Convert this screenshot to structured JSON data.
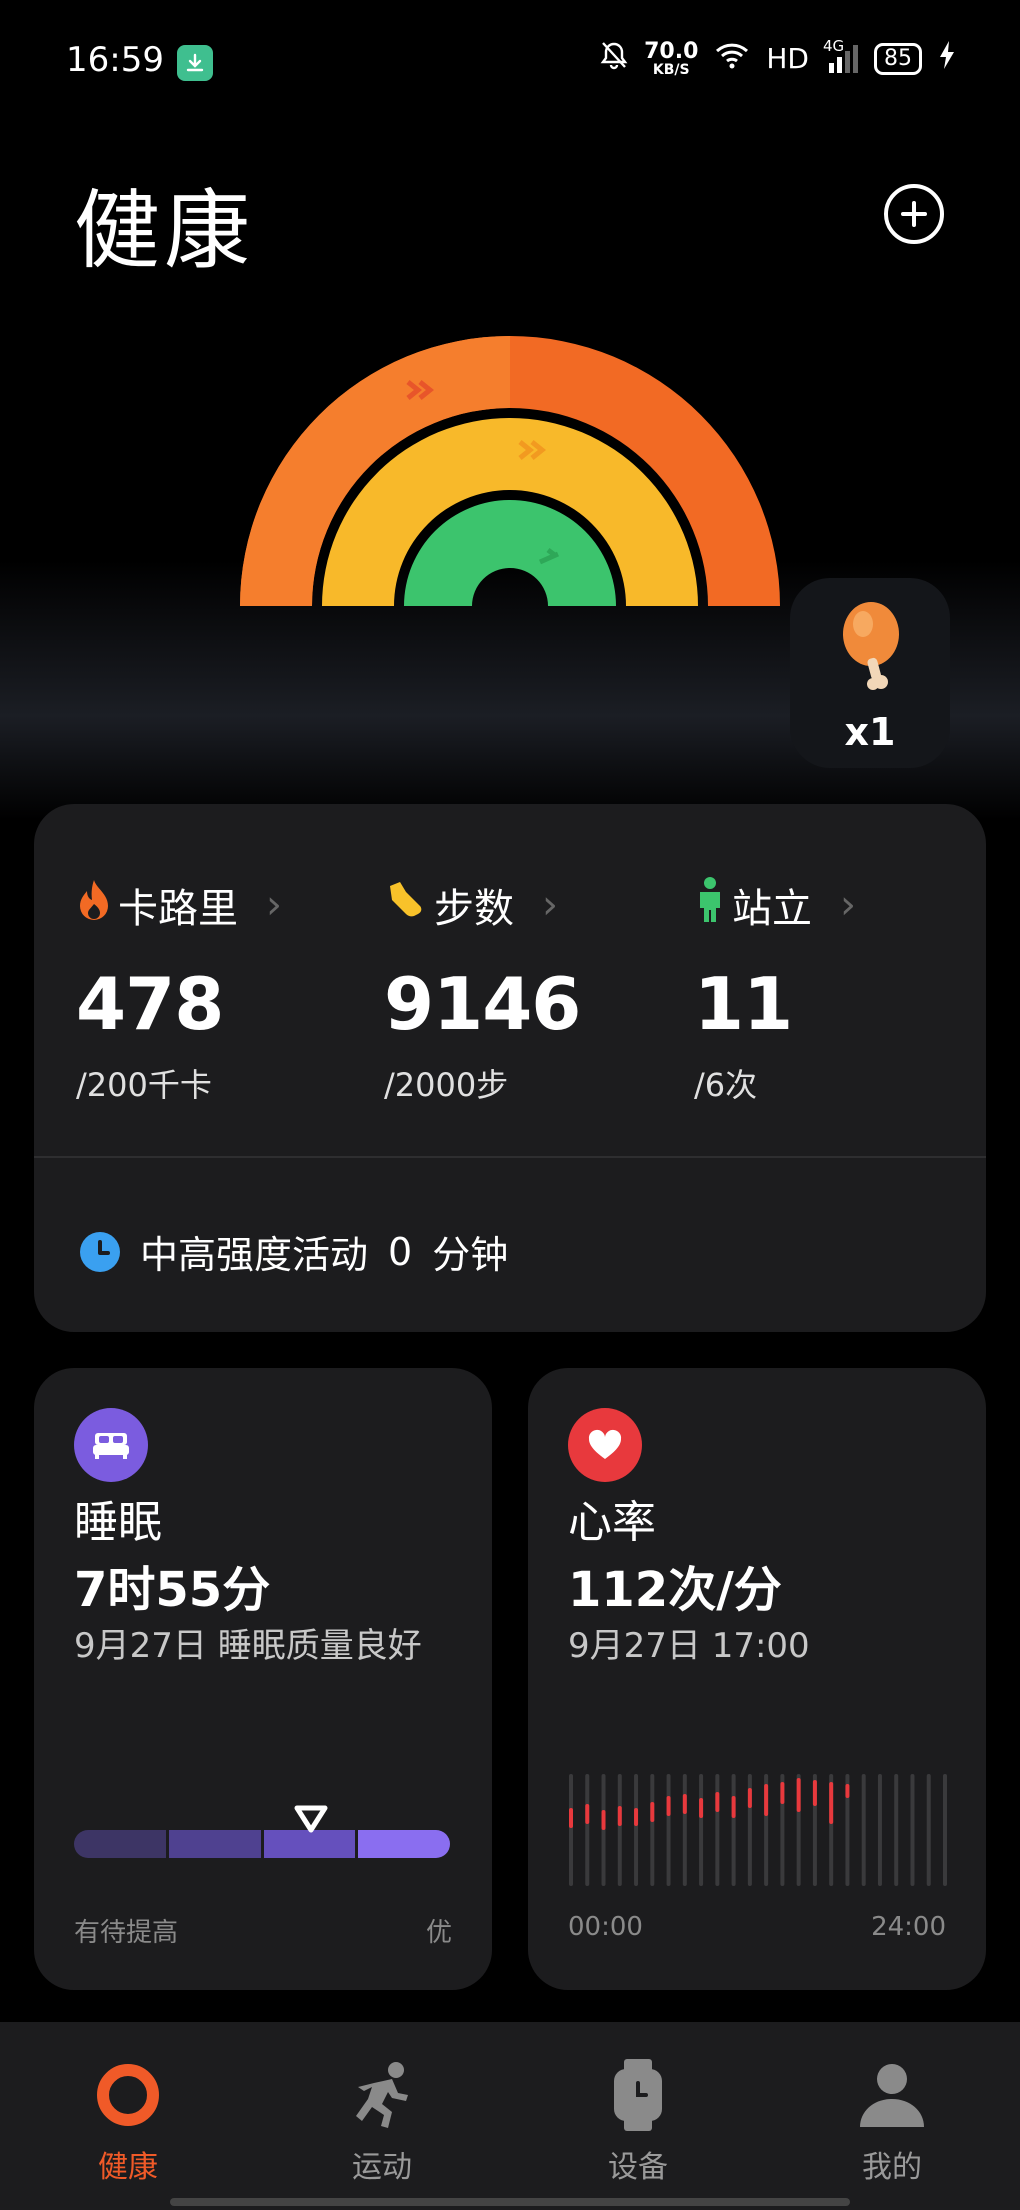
{
  "status_bar": {
    "time": "16:59",
    "net_speed_value": "70.0",
    "net_speed_unit": "KB/S",
    "hd": "HD",
    "network": "4G",
    "battery": "85"
  },
  "header": {
    "title": "健康"
  },
  "rings": {
    "colors": {
      "outer": "#f26a24",
      "middle": "#f8b92a",
      "inner": "#3cc46d"
    }
  },
  "reward": {
    "count": "x1",
    "icon": "drumstick-icon"
  },
  "activity": {
    "metrics": [
      {
        "label": "卡路里",
        "value": "478",
        "goal": "/200千卡",
        "icon": "flame-icon",
        "color": "#f26a24"
      },
      {
        "label": "步数",
        "value": "9146",
        "goal": "/2000步",
        "icon": "shoe-icon",
        "color": "#f8c22a"
      },
      {
        "label": "站立",
        "value": "11",
        "goal": "/6次",
        "icon": "person-standing-icon",
        "color": "#3cc46d"
      }
    ],
    "intensity_text": "中高强度活动",
    "intensity_value": "0",
    "intensity_unit": "分钟"
  },
  "sleep": {
    "title": "睡眠",
    "value": "7时55分",
    "subtitle": "9月27日 睡眠质量良好",
    "scale_low": "有待提高",
    "scale_high": "优",
    "level_fraction": 0.63,
    "color": "#7b5cdf"
  },
  "heart_rate": {
    "title": "心率",
    "value": "112次/分",
    "subtitle": "9月27日 17:00",
    "axis_start": "00:00",
    "axis_end": "24:00",
    "color": "#e8393d"
  },
  "nav": {
    "items": [
      {
        "label": "健康",
        "icon": "ring-icon",
        "active": true
      },
      {
        "label": "运动",
        "icon": "runner-icon",
        "active": false
      },
      {
        "label": "设备",
        "icon": "watch-icon",
        "active": false
      },
      {
        "label": "我的",
        "icon": "profile-icon",
        "active": false
      }
    ]
  }
}
